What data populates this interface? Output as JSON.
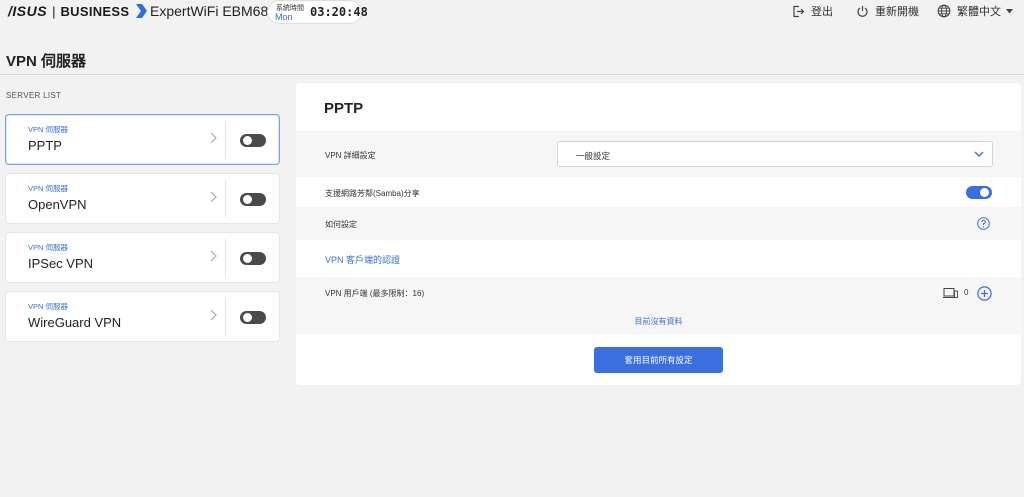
{
  "header": {
    "logo_brand": "/ISUS",
    "logo_sep": "|",
    "logo_business": "BUSINESS",
    "model": "ExpertWiFi EBM68",
    "clock": {
      "label": "系統時間",
      "day": "Mon",
      "time": "03:20:48"
    },
    "logout_label": "登出",
    "reboot_label": "重新開機",
    "language_label": "繁體中文"
  },
  "page": {
    "title": "VPN 伺服器"
  },
  "server_list": {
    "label": "SERVER LIST",
    "items": [
      {
        "sub": "VPN 伺服器",
        "name": "PPTP",
        "enabled": false,
        "active": true
      },
      {
        "sub": "VPN 伺服器",
        "name": "OpenVPN",
        "enabled": false,
        "active": false
      },
      {
        "sub": "VPN 伺服器",
        "name": "IPSec VPN",
        "enabled": false,
        "active": false
      },
      {
        "sub": "VPN 伺服器",
        "name": "WireGuard VPN",
        "enabled": false,
        "active": false
      }
    ]
  },
  "panel": {
    "title": "PPTP",
    "advanced_label": "VPN 詳細設定",
    "advanced_value": "一般設定",
    "samba_label": "支援網路芳鄰(Samba)分享",
    "samba_enabled": true,
    "howto_label": "如何設定",
    "client_auth_label": "VPN 客戶端的認證",
    "users_label": "VPN 用戶端 (最多限制：16)",
    "users_count": "0",
    "no_data": "目前沒有資料",
    "apply_label": "套用目前所有設定"
  },
  "colors": {
    "accent": "#3b6fe0",
    "link": "#3a6fd8",
    "toggle_off": "#4a4a4a"
  }
}
